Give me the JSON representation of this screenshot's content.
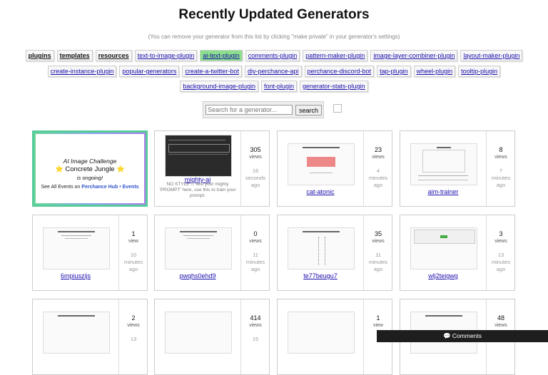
{
  "title": "Recently Updated Generators",
  "subtitle": "(You can remove your generator from this list by clicking \"make private\" in your generator's settings)",
  "tags_row1": [
    "plugins",
    "templates",
    "resources",
    "text-to-image-plugin",
    "ai-text-plugin",
    "comments-plugin",
    "pattern-maker-plugin",
    "image-layer-combiner-plugin",
    "layout-maker-plugin"
  ],
  "tags_row2": [
    "create-instance-plugin",
    "popular-generators",
    "create-a-twitter-bot",
    "diy-perchance-api",
    "perchance-discord-bot",
    "tap-plugin",
    "wheel-plugin",
    "tooltip-plugin"
  ],
  "tags_row3": [
    "background-image-plugin",
    "font-plugin",
    "generator-stats-plugin"
  ],
  "search": {
    "placeholder": "Search for a generator...",
    "button": "search"
  },
  "promo": {
    "title": "AI Image Challenge",
    "name": "⭐ Concrete Jungle ⭐",
    "status": "is ongoing!",
    "events_prefix": "See All Events on",
    "events_link": "Perchance Hub • Events"
  },
  "cards": [
    {
      "name": "mighty-ai",
      "desc": "NO STYLE !!. test your mighty 'PROMPT' here, use this to train your prompt.",
      "views": "305",
      "views_label": "views",
      "time_num": "16",
      "time_unit": "seconds",
      "time_ago": "ago"
    },
    {
      "name": "cat-atonic",
      "views": "23",
      "views_label": "views",
      "time_num": "4",
      "time_unit": "minutes",
      "time_ago": "ago"
    },
    {
      "name": "aim-trainer",
      "views": "8",
      "views_label": "views",
      "time_num": "7",
      "time_unit": "minutes",
      "time_ago": "ago"
    },
    {
      "name": "6mpiuszijs",
      "views": "1",
      "views_label": "view",
      "time_num": "10",
      "time_unit": "minutes",
      "time_ago": "ago"
    },
    {
      "name": "pwqhs0ehd9",
      "views": "0",
      "views_label": "views",
      "time_num": "11",
      "time_unit": "minutes",
      "time_ago": "ago"
    },
    {
      "name": "te77beugu7",
      "views": "35",
      "views_label": "views",
      "time_num": "11",
      "time_unit": "minutes",
      "time_ago": "ago"
    },
    {
      "name": "wlj2teigwg",
      "views": "3",
      "views_label": "views",
      "time_num": "13",
      "time_unit": "minutes",
      "time_ago": "ago"
    },
    {
      "views": "2",
      "views_label": "views",
      "time_num": "13"
    },
    {
      "views": "414",
      "views_label": "views",
      "time_num": "15"
    },
    {
      "views": "1",
      "views_label": "view"
    },
    {
      "views": "48",
      "views_label": "views"
    }
  ],
  "comments_label": "💬 Comments"
}
